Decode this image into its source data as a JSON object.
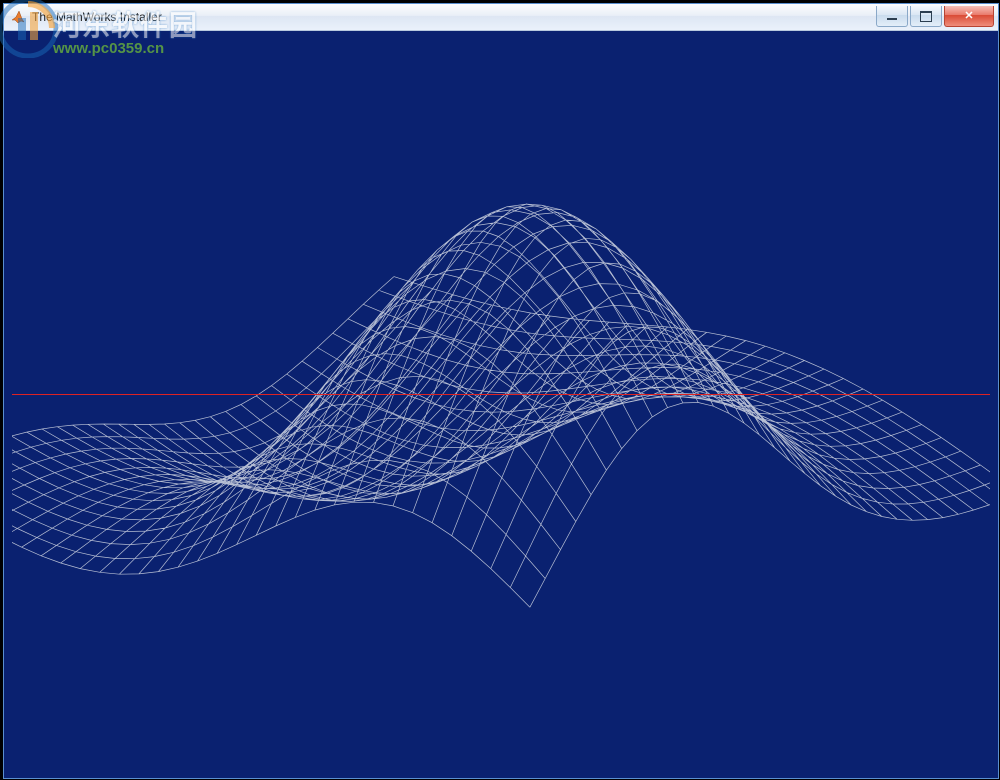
{
  "window": {
    "title": "The MathWorks Installer",
    "controls": {
      "minimize": "minimize",
      "maximize": "maximize",
      "close": "✕"
    }
  },
  "colors": {
    "canvas_bg": "#0a2170",
    "mesh_line": "#d6dbe5",
    "progress_line": "#d22"
  },
  "progress": {
    "line_y_fraction": 0.487
  },
  "surface": {
    "description": "MATLAB membrane L-shaped wireframe surface",
    "grid": 33,
    "function": "first eigenfunction of L-shaped membrane"
  },
  "watermark": {
    "brand": "河东软件园",
    "url": "www.pc0359.cn"
  }
}
